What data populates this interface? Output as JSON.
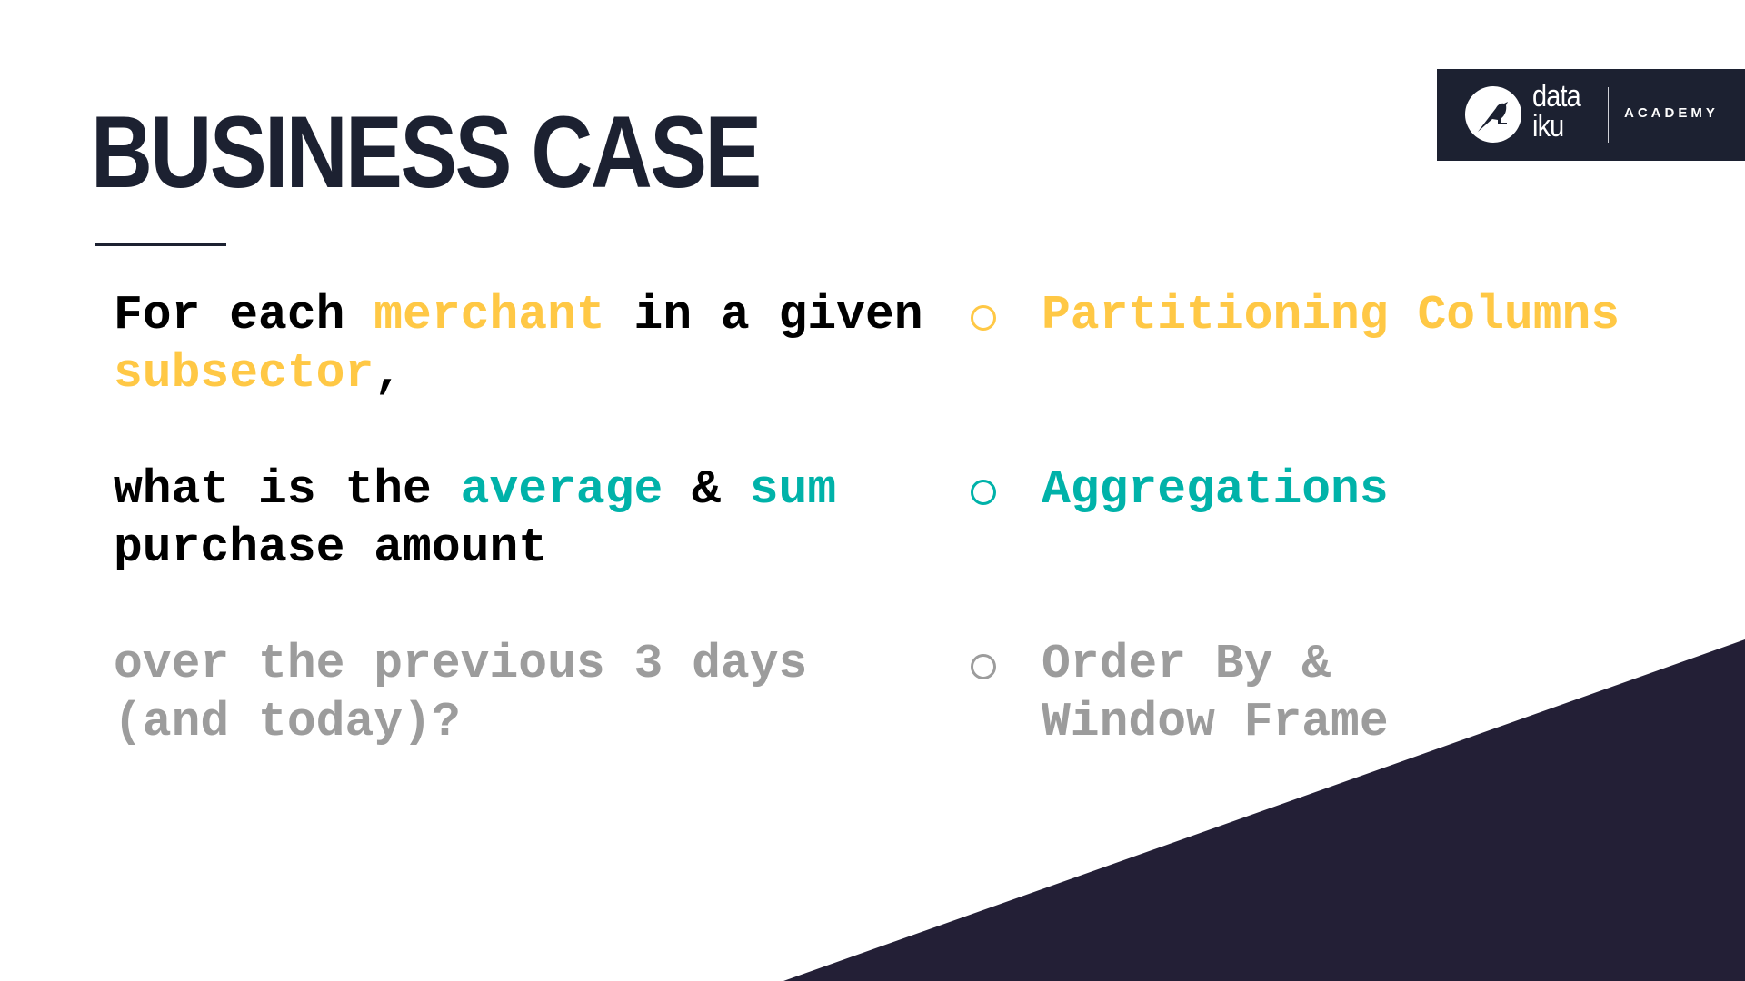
{
  "slide": {
    "title": "BUSINESS CASE",
    "colors": {
      "title": "#1c2131",
      "highlight_yellow": "#ffc845",
      "highlight_teal": "#00b2a9",
      "muted_gray": "#9c9c9c",
      "text": "#000000",
      "triangle": "#231f36"
    }
  },
  "logo": {
    "icon": "dataiku-bird-icon",
    "wordmark_line1": "data",
    "wordmark_line2": "iku",
    "subtitle": "ACADEMY"
  },
  "question": {
    "part1": {
      "t1": "For each ",
      "t2": "merchant",
      "t3": " in a given",
      "t4": "subsector",
      "t5": ","
    },
    "part2": {
      "t1": "what is the ",
      "t2": "average",
      "t3": " & ",
      "t4": "sum",
      "t5": "purchase amount"
    },
    "part3": {
      "line1": "over the previous 3 days",
      "line2": "(and today)?"
    }
  },
  "concepts": [
    {
      "line1": "Partitioning Columns",
      "line2": ""
    },
    {
      "line1": "Aggregations",
      "line2": ""
    },
    {
      "line1": "Order By &",
      "line2": "Window Frame"
    }
  ]
}
